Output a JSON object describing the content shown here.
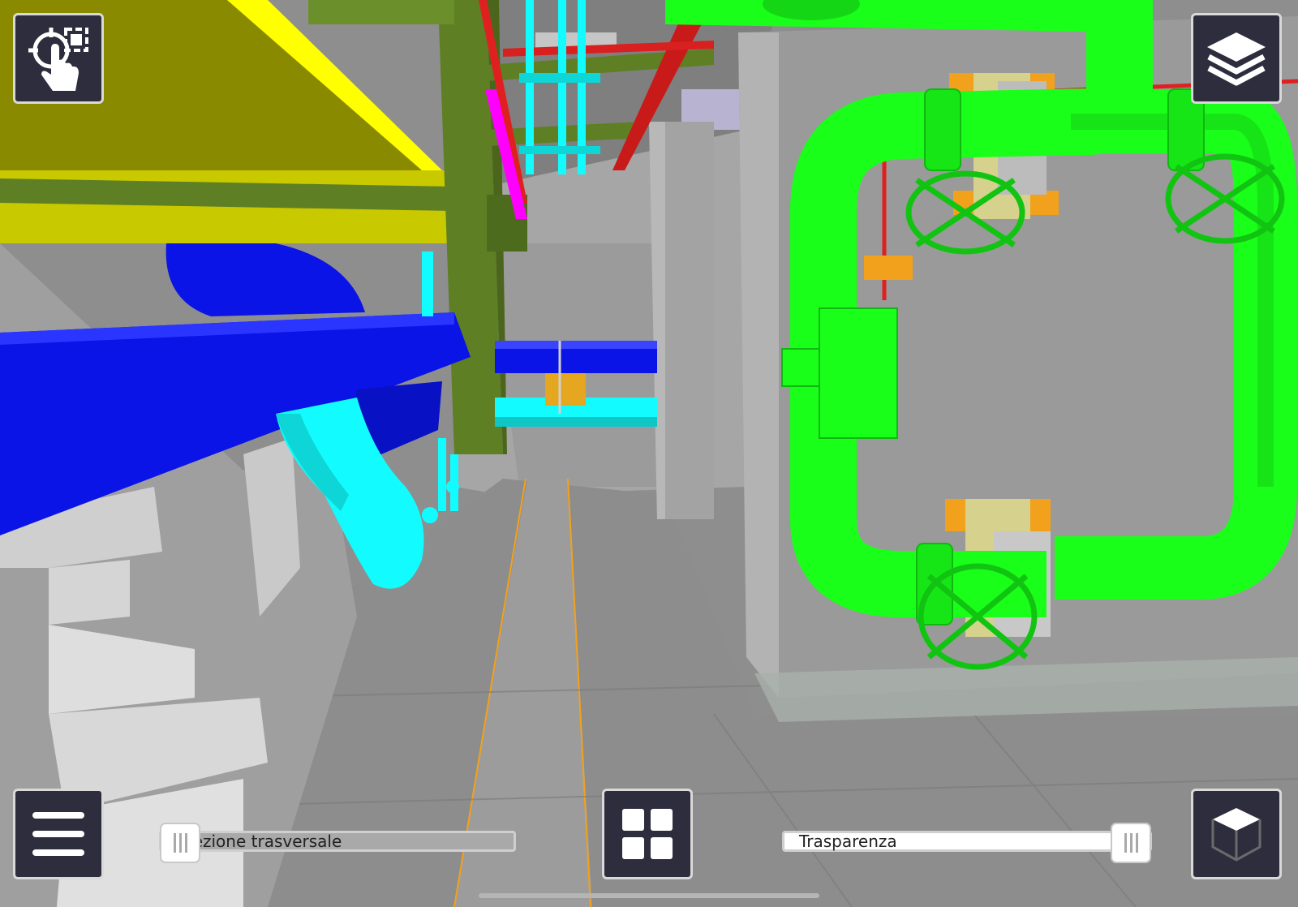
{
  "scene": {
    "description_icons": "3d-bim-model-viewport",
    "colors": {
      "green_pipe": "#19ff19",
      "blue_duct": "#0a14e6",
      "cyan_pipe": "#12fbff",
      "yellow_slab": "#ffff00",
      "olive_beam": "#5e7f24",
      "red_pipe": "#e02020",
      "magenta_pipe": "#ff00ff",
      "floor_gray": "#8c8c8c",
      "accent_orange": "#f2a11c"
    }
  },
  "toolbar": {
    "select_icon": "touch-select-icon",
    "layers_icon": "layers-icon",
    "menu_icon": "hamburger-menu-icon",
    "grid_icon": "grid-view-icon",
    "cube_icon": "cube-view-icon"
  },
  "sliders": {
    "section": {
      "label": "Sezione trasversale",
      "value_percent": 0
    },
    "transparency": {
      "label": "Trasparenza",
      "value_percent": 100
    }
  },
  "colors": {
    "button_bg": "#2e2d3d",
    "button_border": "#d9d9d9",
    "section_track": "#a9a9a9",
    "transparency_track": "#ffffff"
  }
}
